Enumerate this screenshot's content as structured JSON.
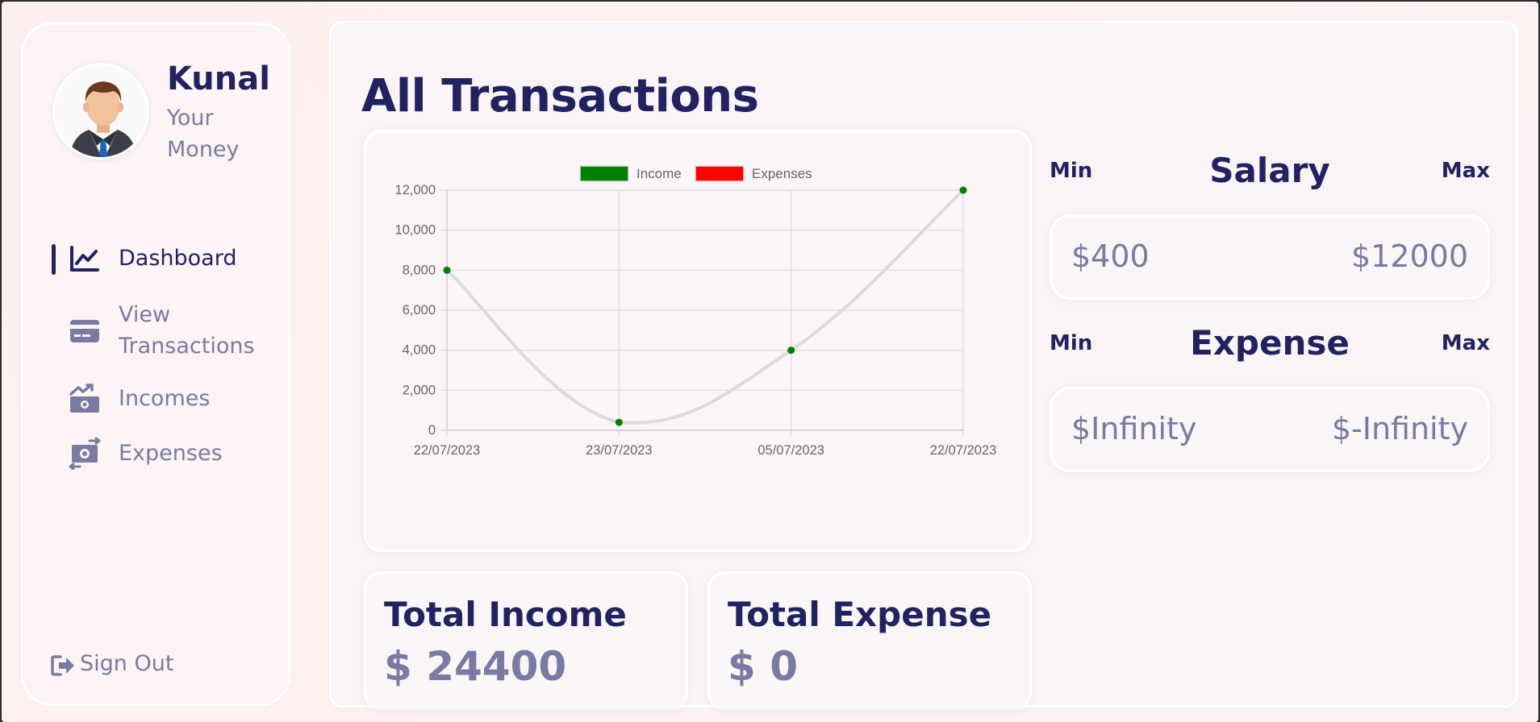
{
  "user": {
    "name": "Kunal",
    "tagline": "Your Money"
  },
  "nav": {
    "items": [
      {
        "label": "Dashboard",
        "icon": "chart-line-icon",
        "active": true
      },
      {
        "label": "View Transactions",
        "icon": "credit-card-icon",
        "active": false
      },
      {
        "label": "Incomes",
        "icon": "money-trend-icon",
        "active": false
      },
      {
        "label": "Expenses",
        "icon": "money-exchange-icon",
        "active": false
      }
    ],
    "signout_label": "Sign Out",
    "signout_icon": "sign-out-icon"
  },
  "main": {
    "title": "All Transactions",
    "total_income": {
      "label": "Total Income",
      "value": "$ 24400"
    },
    "total_expense": {
      "label": "Total Expense",
      "value": "$ 0"
    },
    "salary": {
      "min_label": "Min",
      "title": "Salary",
      "max_label": "Max",
      "min_value": "$400",
      "max_value": "$12000"
    },
    "expense": {
      "min_label": "Min",
      "title": "Expense",
      "max_label": "Max",
      "min_value": "$Infinity",
      "max_value": "$-Infinity"
    }
  },
  "colors": {
    "primary": "#222260",
    "muted": "#7a7aa2",
    "income": "#008000",
    "expenses": "#ff0000"
  },
  "chart_data": {
    "type": "line",
    "categories": [
      "22/07/2023",
      "23/07/2023",
      "05/07/2023",
      "22/07/2023"
    ],
    "series": [
      {
        "name": "Income",
        "values": [
          8000,
          400,
          4000,
          12000
        ],
        "color": "#008000"
      },
      {
        "name": "Expenses",
        "values": [],
        "color": "#ff0000"
      }
    ],
    "ylim": [
      0,
      12000
    ],
    "yticks": [
      0,
      2000,
      4000,
      6000,
      8000,
      10000,
      12000
    ],
    "ytick_labels": [
      "0",
      "2,000",
      "4,000",
      "6,000",
      "8,000",
      "10,000",
      "12,000"
    ],
    "legend": [
      "Income",
      "Expenses"
    ],
    "legend_position": "top",
    "grid": true
  }
}
